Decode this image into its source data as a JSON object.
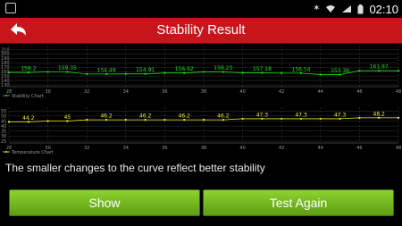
{
  "status_bar": {
    "time": "02:10"
  },
  "header": {
    "title": "Stability Result"
  },
  "message": "The smaller changes to the curve reflect better stability",
  "buttons": {
    "show": "Show",
    "test_again": "Test Again"
  },
  "colors": {
    "header_red": "#c8151b",
    "stability_line": "#19e219",
    "temperature_line": "#f2f21e",
    "button_green": "#6fb11c"
  },
  "chart_data": [
    {
      "type": "line",
      "legend": "Stability Chart",
      "x": [
        28,
        29,
        30,
        31,
        32,
        33,
        34,
        35,
        36,
        37,
        38,
        39,
        40,
        41,
        42,
        43,
        44,
        45,
        46,
        47,
        48
      ],
      "xticks": [
        28,
        30,
        32,
        34,
        36,
        38,
        40,
        42,
        44,
        46,
        48
      ],
      "yticks": [
        210,
        200,
        190,
        180,
        170,
        160,
        150,
        140,
        130
      ],
      "ylim": [
        130,
        215
      ],
      "values": [
        158.2,
        158.2,
        159.35,
        159.35,
        154.49,
        154.49,
        154.91,
        154.91,
        156.92,
        156.92,
        159.23,
        159.23,
        157.18,
        157.18,
        156.54,
        156.54,
        153.36,
        153.36,
        161.97,
        161.97,
        161.97
      ],
      "labels": [
        {
          "x": 29,
          "text": "158.2"
        },
        {
          "x": 31,
          "text": "159.35"
        },
        {
          "x": 33,
          "text": "154.49"
        },
        {
          "x": 35,
          "text": "154.91"
        },
        {
          "x": 37,
          "text": "156.92"
        },
        {
          "x": 39,
          "text": "159.23"
        },
        {
          "x": 41,
          "text": "157.18"
        },
        {
          "x": 43,
          "text": "156.54"
        },
        {
          "x": 45,
          "text": "153.36"
        },
        {
          "x": 47,
          "text": "161.97"
        }
      ]
    },
    {
      "type": "line",
      "legend": "Temperature Chart",
      "x": [
        28,
        29,
        30,
        31,
        32,
        33,
        34,
        35,
        36,
        37,
        38,
        39,
        40,
        41,
        42,
        43,
        44,
        45,
        46,
        47,
        48
      ],
      "xticks": [
        28,
        30,
        32,
        34,
        36,
        38,
        40,
        42,
        44,
        46,
        48
      ],
      "yticks": [
        55,
        50,
        45,
        40,
        35,
        30,
        25
      ],
      "ylim": [
        25,
        57
      ],
      "values": [
        44.2,
        44.2,
        45,
        45,
        46.2,
        46.2,
        46.2,
        46.2,
        46.2,
        46.2,
        46.2,
        46.2,
        47.3,
        47.3,
        47.3,
        47.3,
        47.3,
        47.3,
        48.2,
        48.2,
        48.2
      ],
      "labels": [
        {
          "x": 29,
          "text": "44.2"
        },
        {
          "x": 31,
          "text": "45"
        },
        {
          "x": 33,
          "text": "46.2"
        },
        {
          "x": 35,
          "text": "46.2"
        },
        {
          "x": 37,
          "text": "46.2"
        },
        {
          "x": 39,
          "text": "46.2"
        },
        {
          "x": 41,
          "text": "47.3"
        },
        {
          "x": 43,
          "text": "47.3"
        },
        {
          "x": 45,
          "text": "47.3"
        },
        {
          "x": 47,
          "text": "48.2"
        }
      ]
    }
  ]
}
